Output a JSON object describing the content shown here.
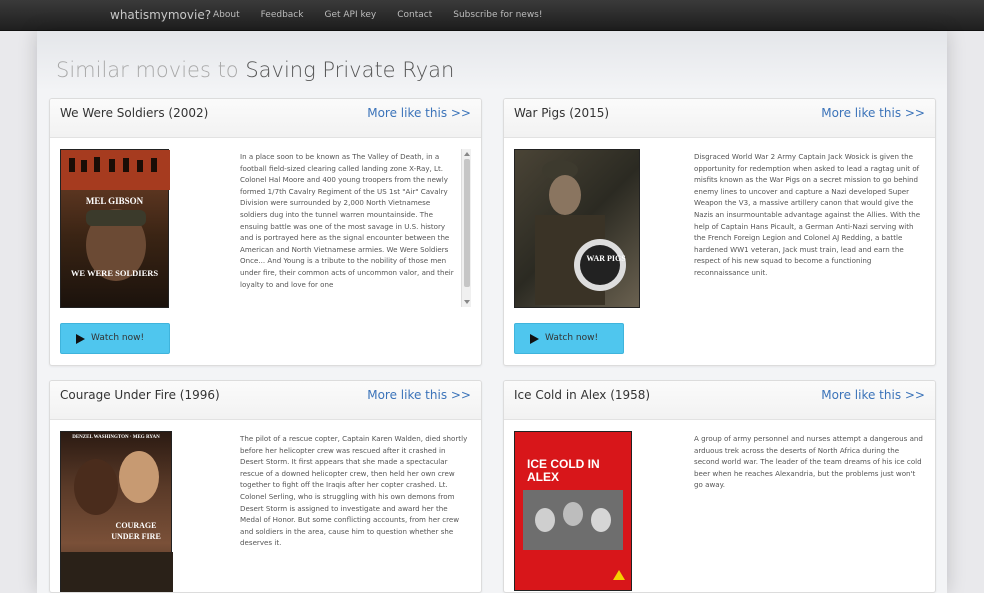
{
  "navbar": {
    "brand": "whatismymovie?",
    "links": [
      "About",
      "Feedback",
      "Get API key",
      "Contact",
      "Subscribe for news!"
    ]
  },
  "page": {
    "title_prefix": "Similar movies to",
    "title_movie": "Saving Private Ryan"
  },
  "cards": [
    {
      "title": "We Were Soldiers (2002)",
      "more": "More like this >>",
      "watch": "Watch now!",
      "poster_top": "MEL GIBSON",
      "poster_bottom": "WE WERE SOLDIERS",
      "description": "In a place soon to be known as The Valley of Death, in a football field-sized clearing called landing zone X-Ray, Lt. Colonel Hal Moore and 400 young troopers from the newly formed 1/7th Cavalry Regiment of the US 1st \"Air\" Cavalry Division were surrounded by 2,000 North Vietnamese soldiers dug into the tunnel warren mountainside. The ensuing battle was one of the most savage in U.S. history and is portrayed here as the signal encounter between the American and North Vietnamese armies. We Were Soldiers Once... And Young is a tribute to the nobility of those men under fire, their common acts of uncommon valor, and their loyalty to and love for one"
    },
    {
      "title": "War Pigs (2015)",
      "more": "More like this >>",
      "watch": "Watch now!",
      "poster_top": "WAR PIGS",
      "description": "Disgraced World War 2 Army Captain Jack Wosick is given the opportunity for redemption when asked to lead a ragtag unit of misfits known as the War Pigs on a secret mission to go behind enemy lines to uncover and capture a Nazi developed Super Weapon the V3, a massive artillery canon that would give the Nazis an insurmountable advantage against the Allies. With the help of Captain Hans Picault, a German Anti-Nazi serving with the French Foreign Legion and Colonel AJ Redding, a battle hardened WW1 veteran, Jack must train, lead and earn the respect of his new squad to become a functioning reconnaissance unit."
    },
    {
      "title": "Courage Under Fire (1996)",
      "more": "More like this >>",
      "poster_top": "DENZEL WASHINGTON · MEG RYAN",
      "poster_bottom": "COURAGE UNDER FIRE",
      "description": "The pilot of a rescue copter, Captain Karen Walden, died shortly before her helicopter crew was rescued after it crashed in Desert Storm. It first appears that she made a spectacular rescue of a downed helicopter crew, then held her own crew together to fight off the Iraqis after her copter crashed. Lt. Colonel Serling, who is struggling with his own demons from Desert Storm is assigned to investigate and award her the Medal of Honor. But some conflicting accounts, from her crew and soldiers in the area, cause him to question whether she deserves it."
    },
    {
      "title": "Ice Cold in Alex (1958)",
      "more": "More like this >>",
      "poster_top": "ICE COLD IN ALEX",
      "description": "A group of army personnel and nurses attempt a dangerous and arduous trek across the deserts of North Africa during the second world war. The leader of the team dreams of his ice cold beer when he reaches Alexandria, but the problems just won't go away."
    }
  ],
  "colors": {
    "button": "#4fc6ee",
    "link": "#3b73b9",
    "navbar": "#2a2a2a"
  }
}
